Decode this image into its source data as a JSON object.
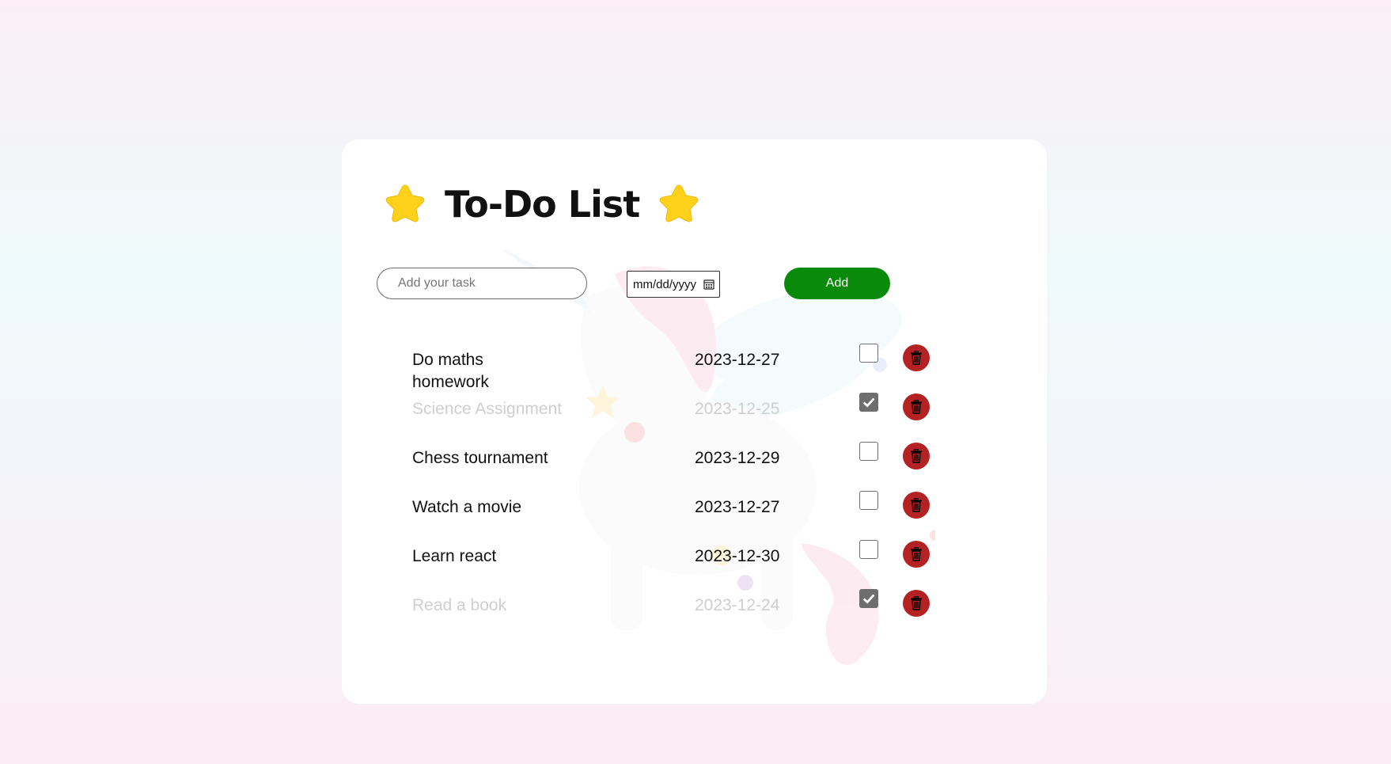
{
  "app": {
    "title": "To-Do List",
    "colors": {
      "background_top": "#fbeef5",
      "background_mid": "#eefafb",
      "card": "#ffffff",
      "add_button": "#0a8a0a",
      "delete_button": "#b52224",
      "star": "#ffd11a",
      "done_text": "#cfcfcf"
    }
  },
  "form": {
    "task_placeholder": "Add your task",
    "date_placeholder": "mm/dd/yyyy",
    "add_label": "Add"
  },
  "tasks": [
    {
      "name": "Do maths homework",
      "date": "2023-12-27",
      "done": false
    },
    {
      "name": "Science Assignment",
      "date": "2023-12-25",
      "done": true
    },
    {
      "name": "Chess tournament",
      "date": "2023-12-29",
      "done": false
    },
    {
      "name": "Watch a movie",
      "date": "2023-12-27",
      "done": false
    },
    {
      "name": "Learn react",
      "date": "2023-12-30",
      "done": false
    },
    {
      "name": "Read a book",
      "date": "2023-12-24",
      "done": true
    }
  ],
  "icons": {
    "title_left": "star-icon",
    "title_right": "star-icon",
    "date_picker": "calendar-icon",
    "delete": "trash-icon",
    "check": "check-icon"
  }
}
